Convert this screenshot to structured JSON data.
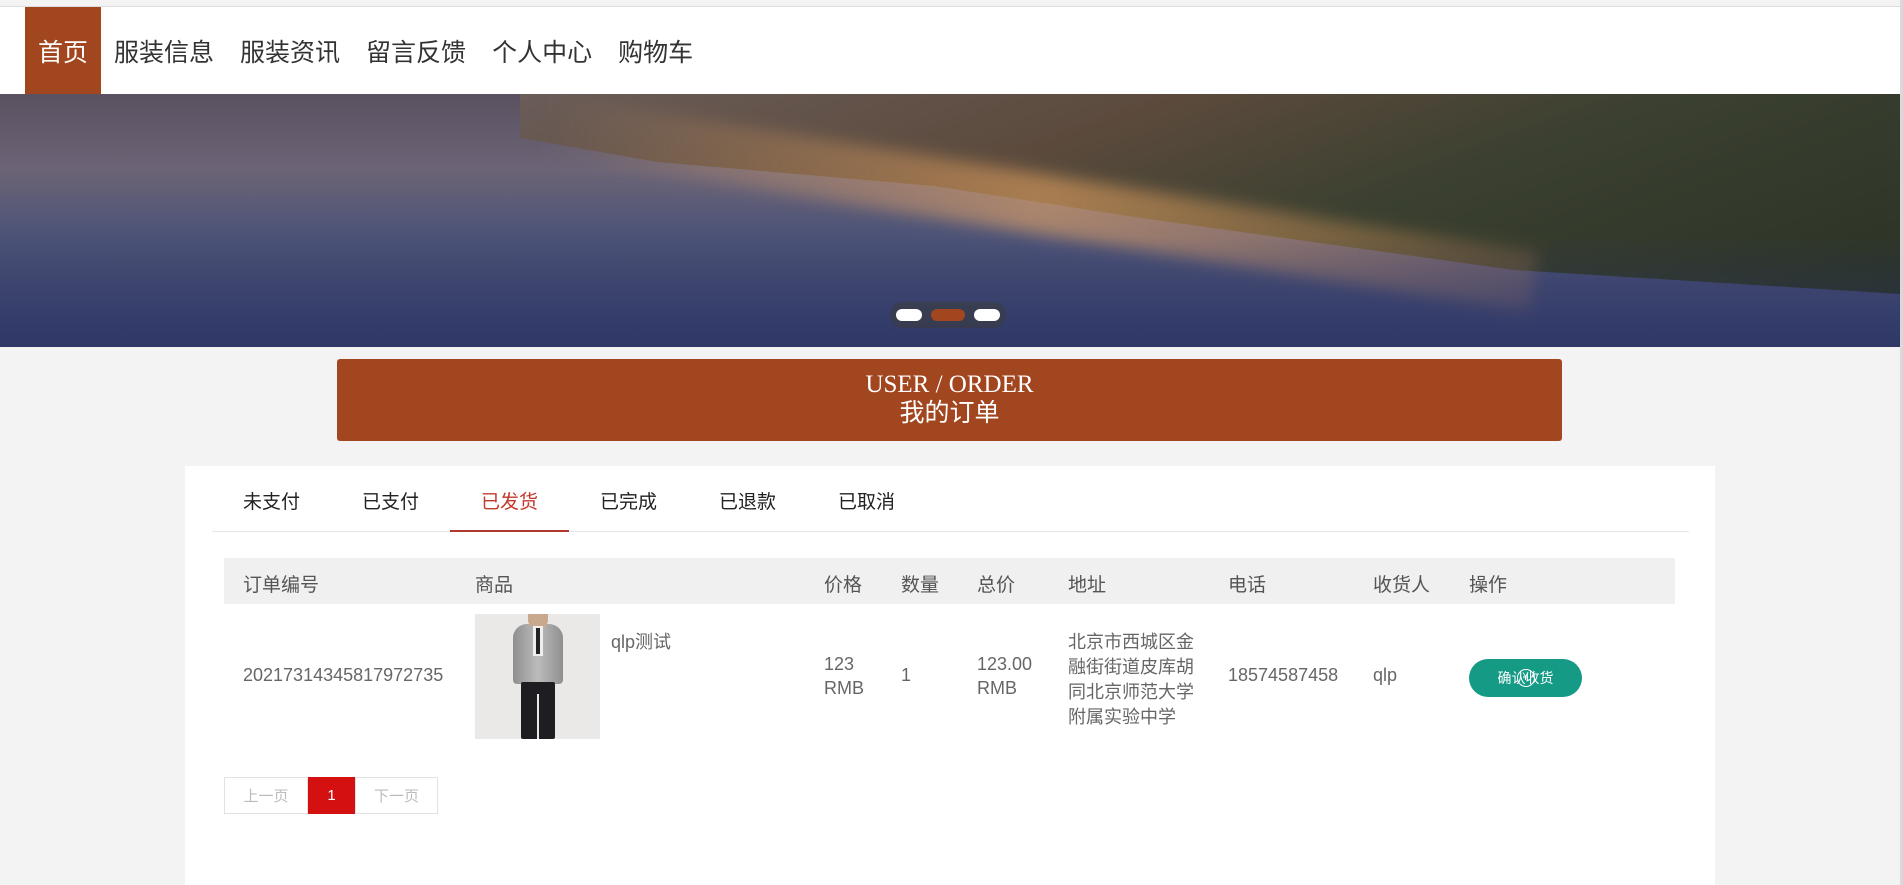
{
  "nav": {
    "items": [
      "首页",
      "服装信息",
      "服装资讯",
      "留言反馈",
      "个人中心",
      "购物车"
    ]
  },
  "header": {
    "title_en": "USER / ORDER",
    "title_cn": "我的订单"
  },
  "tabs": [
    "未支付",
    "已支付",
    "已发货",
    "已完成",
    "已退款",
    "已取消"
  ],
  "active_tab": "已发货",
  "table": {
    "headers": [
      "订单编号",
      "商品",
      "价格",
      "数量",
      "总价",
      "地址",
      "电话",
      "收货人",
      "操作"
    ],
    "rows": [
      {
        "order_id": "20217314345817972735",
        "product_name": "qlp测试",
        "price_line1": "123",
        "price_line2": "RMB",
        "quantity": "1",
        "total_line1": "123.00",
        "total_line2": "RMB",
        "address_lines": [
          "北京市西城区金",
          "融街街道皮库胡",
          "同北京师范大学",
          "附属实验中学"
        ],
        "phone": "18574587458",
        "receiver": "qlp",
        "action_label": "确认收货",
        "action_icon": "yen-icon"
      }
    ]
  },
  "pagination": {
    "prev": "上一页",
    "current": "1",
    "next": "下一页"
  },
  "colors": {
    "brand": "#a2461f",
    "confirm_button": "#159a86",
    "active_page": "#d41010"
  }
}
